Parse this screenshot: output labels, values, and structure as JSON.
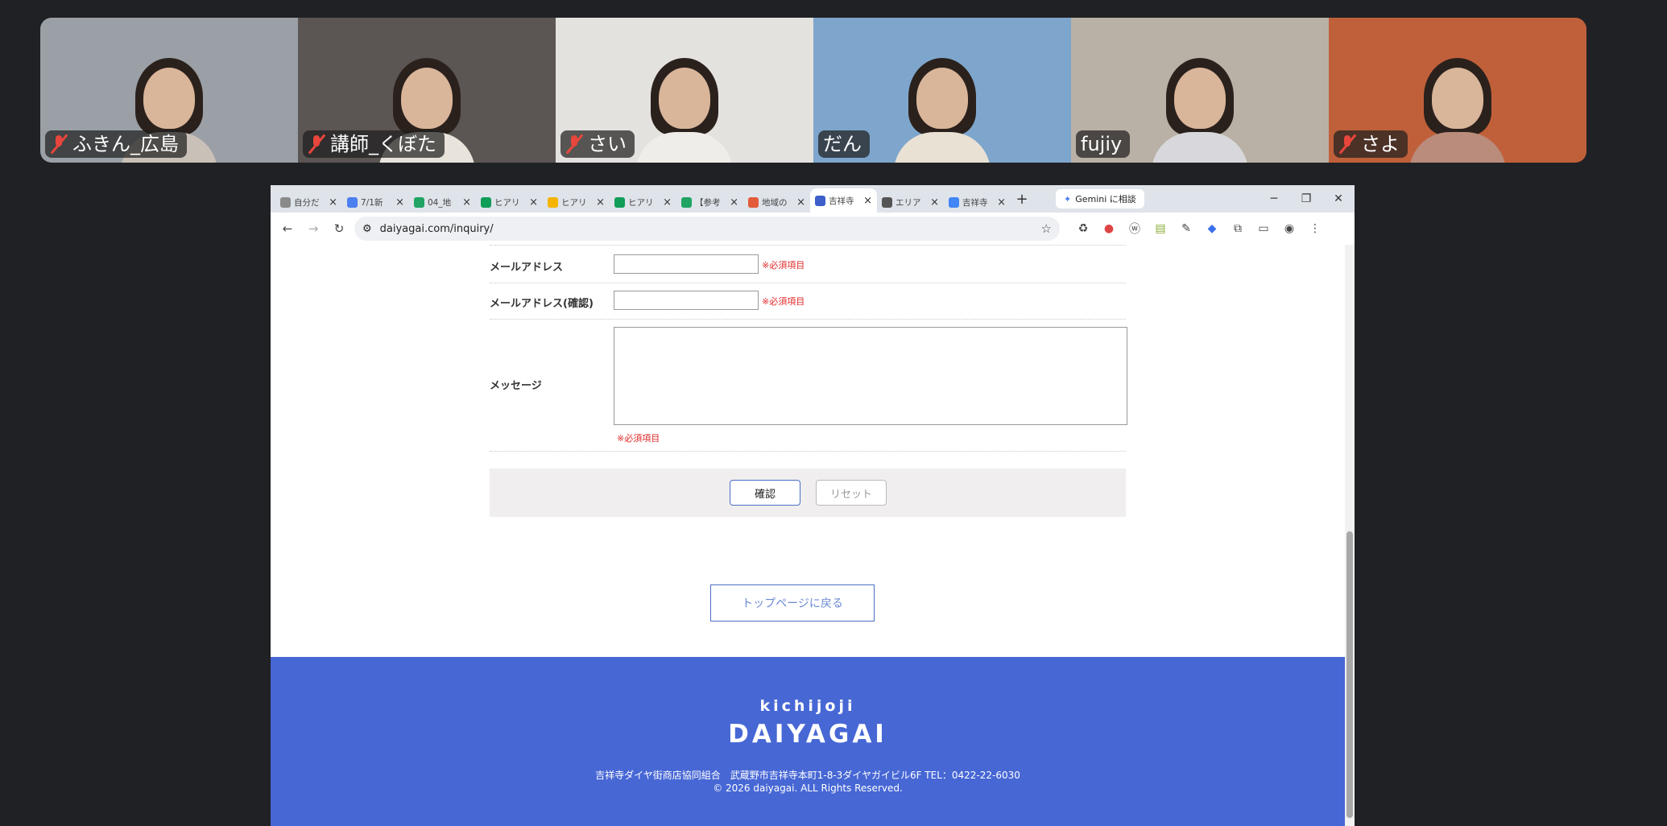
{
  "participants": [
    {
      "name": "ふきん_広島",
      "muted": true,
      "bg": "#9aa0a6",
      "body": "#c9c0b8"
    },
    {
      "name": "講師_くぼた",
      "muted": true,
      "bg": "#5b5553",
      "body": "#e8e4dc"
    },
    {
      "name": "さい",
      "muted": true,
      "bg": "#e4e2df",
      "body": "#efede9"
    },
    {
      "name": "だん",
      "muted": false,
      "bg": "#7ea6cc",
      "body": "#e9e1d4"
    },
    {
      "name": "fujiy",
      "muted": false,
      "bg": "#b9b1a6",
      "body": "#d8d8dc",
      "active": true
    },
    {
      "name": "さよ",
      "muted": true,
      "bg": "#c0603a",
      "body": "#b98c7c"
    }
  ],
  "tabs": [
    {
      "label": "自分だ",
      "fav": "#8a8a8a"
    },
    {
      "label": "7/1新",
      "fav": "#4c7ff0"
    },
    {
      "label": "04_地",
      "fav": "#1fa463"
    },
    {
      "label": "ヒアリ",
      "fav": "#0f9d58"
    },
    {
      "label": "ヒアリ",
      "fav": "#f4b400"
    },
    {
      "label": "ヒアリ",
      "fav": "#0f9d58"
    },
    {
      "label": "【参考",
      "fav": "#1fa463"
    },
    {
      "label": "地域の",
      "fav": "#e25b3b"
    },
    {
      "label": "吉祥寺",
      "fav": "#3d5fc9",
      "active": true
    },
    {
      "label": "エリア",
      "fav": "#555555"
    },
    {
      "label": "吉祥寺",
      "fav": "#4285f4"
    }
  ],
  "browser": {
    "gemini_label": "Gemini に相談",
    "url": "daiyagai.com/inquiry/"
  },
  "form": {
    "email_label": "メールアドレス",
    "email_confirm_label": "メールアドレス(確認)",
    "message_label": "メッセージ",
    "required_note": "※必須項目",
    "confirm_button": "確認",
    "reset_button": "リセット",
    "top_link": "トップページに戻る"
  },
  "footer": {
    "logo_top": "kichijoji",
    "logo_main": "DAIYAGAI",
    "address": "吉祥寺ダイヤ街商店協同組合　武蔵野市吉祥寺本町1-8-3ダイヤガイビル6F TEL：0422-22-6030",
    "copyright": "©  2026 daiyagai. ALL Rights Reserved."
  }
}
